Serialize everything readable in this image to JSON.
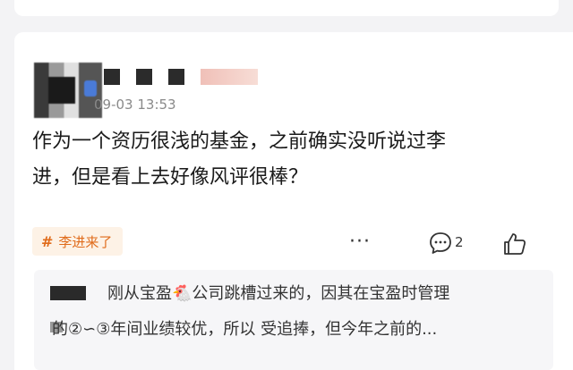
{
  "post": {
    "time": "09-03 13:53",
    "content_line1": "作为一个资历很浅的基金，之前确实没听说过李",
    "content_line2": "进，但是看上去好像风评很棒？",
    "topic": {
      "hash": "#",
      "label": "李进来了"
    },
    "actions": {
      "more": "···",
      "comment_count": "2"
    },
    "reply": {
      "line1": "刚从宝盈🐔公司跳槽过来的，因其在宝盈时管理",
      "line2": "的②∽③年间业绩较优，所以 受追捧，但今年之前的..."
    }
  },
  "colors": {
    "accent": "#e06b1a",
    "topic_bg": "#fdf2e6",
    "time": "#8a8a8a"
  }
}
